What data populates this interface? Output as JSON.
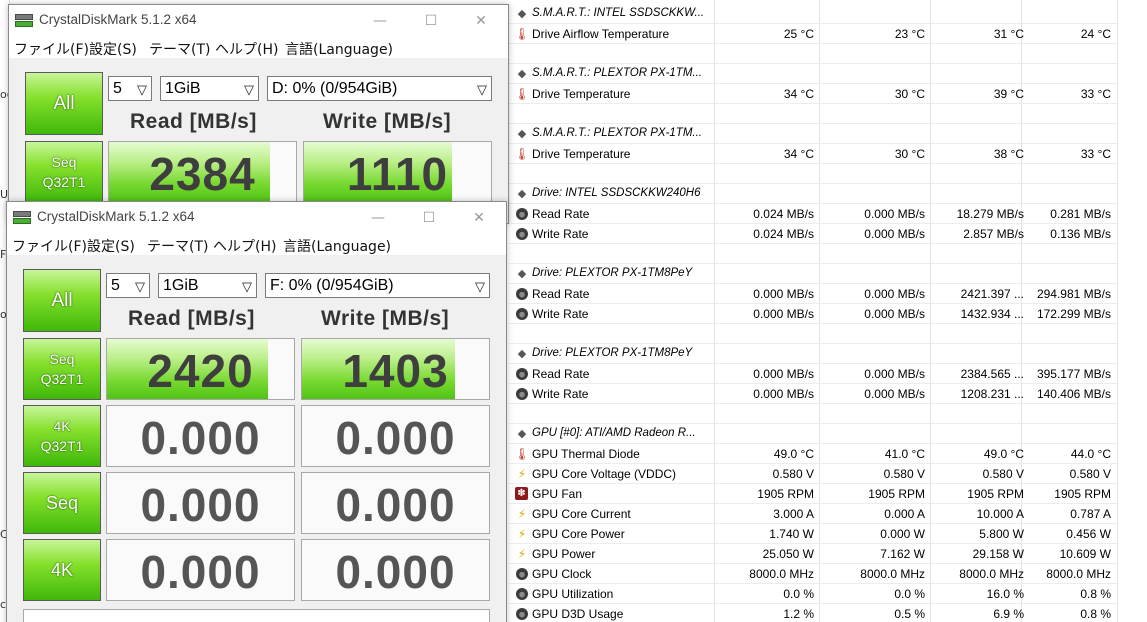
{
  "background": {
    "left_chars": [
      "ос",
      "U",
      "Fa",
      "ol",
      "C",
      "с"
    ]
  },
  "sensors": {
    "rows": [
      {
        "type": "header",
        "icon": "drive-icon",
        "label": "S.M.A.R.T.: INTEL SSDSCKKW..."
      },
      {
        "type": "row",
        "icon": "thermometer-icon",
        "label": "Drive Airflow Temperature",
        "values": [
          "25 °C",
          "23 °C",
          "31 °C",
          "24 °C"
        ]
      },
      {
        "type": "blank"
      },
      {
        "type": "header",
        "icon": "drive-icon",
        "label": "S.M.A.R.T.: PLEXTOR PX-1TM..."
      },
      {
        "type": "row",
        "icon": "thermometer-icon",
        "label": "Drive Temperature",
        "values": [
          "34 °C",
          "30 °C",
          "39 °C",
          "33 °C"
        ]
      },
      {
        "type": "blank"
      },
      {
        "type": "header",
        "icon": "drive-icon",
        "label": "S.M.A.R.T.: PLEXTOR PX-1TM..."
      },
      {
        "type": "row",
        "icon": "thermometer-icon",
        "label": "Drive Temperature",
        "values": [
          "34 °C",
          "30 °C",
          "38 °C",
          "33 °C"
        ]
      },
      {
        "type": "blank"
      },
      {
        "type": "header",
        "icon": "drive-icon",
        "label": "Drive: INTEL SSDSCKKW240H6"
      },
      {
        "type": "row",
        "icon": "gauge-icon",
        "label": "Read Rate",
        "values": [
          "0.024 MB/s",
          "0.000 MB/s",
          "18.279 MB/s",
          "0.281 MB/s"
        ]
      },
      {
        "type": "row",
        "icon": "gauge-icon",
        "label": "Write Rate",
        "values": [
          "0.024 MB/s",
          "0.000 MB/s",
          "2.857 MB/s",
          "0.136 MB/s"
        ]
      },
      {
        "type": "blank"
      },
      {
        "type": "header",
        "icon": "drive-icon",
        "label": "Drive: PLEXTOR PX-1TM8PeY"
      },
      {
        "type": "row",
        "icon": "gauge-icon",
        "label": "Read Rate",
        "values": [
          "0.000 MB/s",
          "0.000 MB/s",
          "2421.397 ...",
          "294.981 MB/s"
        ]
      },
      {
        "type": "row",
        "icon": "gauge-icon",
        "label": "Write Rate",
        "values": [
          "0.000 MB/s",
          "0.000 MB/s",
          "1432.934 ...",
          "172.299 MB/s"
        ]
      },
      {
        "type": "blank"
      },
      {
        "type": "header",
        "icon": "drive-icon",
        "label": "Drive: PLEXTOR PX-1TM8PeY"
      },
      {
        "type": "row",
        "icon": "gauge-icon",
        "label": "Read Rate",
        "values": [
          "0.000 MB/s",
          "0.000 MB/s",
          "2384.565 ...",
          "395.177 MB/s"
        ]
      },
      {
        "type": "row",
        "icon": "gauge-icon",
        "label": "Write Rate",
        "values": [
          "0.000 MB/s",
          "0.000 MB/s",
          "1208.231 ...",
          "140.406 MB/s"
        ]
      },
      {
        "type": "blank"
      },
      {
        "type": "header",
        "icon": "gpu-icon",
        "label": "GPU [#0]: ATI/AMD Radeon R..."
      },
      {
        "type": "row",
        "icon": "thermometer-icon",
        "label": "GPU Thermal Diode",
        "values": [
          "49.0 °C",
          "41.0 °C",
          "49.0 °C",
          "44.0 °C"
        ]
      },
      {
        "type": "row",
        "icon": "bolt-icon",
        "label": "GPU Core Voltage (VDDC)",
        "values": [
          "0.580 V",
          "0.580 V",
          "0.580 V",
          "0.580 V"
        ]
      },
      {
        "type": "row",
        "icon": "fan-icon",
        "label": "GPU Fan",
        "values": [
          "1905 RPM",
          "1905 RPM",
          "1905 RPM",
          "1905 RPM"
        ]
      },
      {
        "type": "row",
        "icon": "bolt-icon",
        "label": "GPU Core Current",
        "values": [
          "3.000 A",
          "0.000 A",
          "10.000 A",
          "0.787 A"
        ]
      },
      {
        "type": "row",
        "icon": "bolt-icon",
        "label": "GPU Core Power",
        "values": [
          "1.740 W",
          "0.000 W",
          "5.800 W",
          "0.456 W"
        ]
      },
      {
        "type": "row",
        "icon": "bolt-icon",
        "label": "GPU Power",
        "values": [
          "25.050 W",
          "7.162 W",
          "29.158 W",
          "10.609 W"
        ]
      },
      {
        "type": "row",
        "icon": "gauge-icon",
        "label": "GPU Clock",
        "values": [
          "8000.0 MHz",
          "8000.0 MHz",
          "8000.0 MHz",
          "8000.0 MHz"
        ]
      },
      {
        "type": "row",
        "icon": "gauge-icon",
        "label": "GPU Utilization",
        "values": [
          "0.0 %",
          "0.0 %",
          "16.0 %",
          "0.8 %"
        ]
      },
      {
        "type": "row",
        "icon": "gauge-icon",
        "label": "GPU D3D Usage",
        "values": [
          "1.2 %",
          "0.5 %",
          "6.9 %",
          "0.8 %"
        ]
      }
    ]
  },
  "cdm_back": {
    "title": "CrystalDiskMark 5.1.2 x64",
    "minimize": "—",
    "maximize": "☐",
    "close": "✕",
    "menu": [
      "ファイル(F)",
      "設定(S)",
      "テーマ(T)",
      "ヘルプ(H)",
      "言語(Language)"
    ],
    "all_label": "All",
    "count": "5",
    "size": "1GiB",
    "drive": "D: 0% (0/954GiB)",
    "read_header": "Read [MB/s]",
    "write_header": "Write [MB/s]",
    "seq_label": "Seq\nQ32T1",
    "read_value": "2384",
    "write_value": "1110",
    "read_fill": 0.86,
    "write_fill": 0.79
  },
  "cdm_front": {
    "title": "CrystalDiskMark 5.1.2 x64",
    "minimize": "—",
    "maximize": "☐",
    "close": "✕",
    "menu": [
      "ファイル(F)",
      "設定(S)",
      "テーマ(T)",
      "ヘルプ(H)",
      "言語(Language)"
    ],
    "all_label": "All",
    "count": "5",
    "size": "1GiB",
    "drive": "F: 0% (0/954GiB)",
    "read_header": "Read [MB/s]",
    "write_header": "Write [MB/s]",
    "tests": [
      {
        "label_line1": "Seq",
        "label_line2": "Q32T1",
        "read": "2420",
        "write": "1403",
        "read_fill": 0.86,
        "write_fill": 0.82
      },
      {
        "label_line1": "4K",
        "label_line2": "Q32T1",
        "read": "0.000",
        "write": "0.000",
        "read_fill": 0,
        "write_fill": 0
      },
      {
        "label_line1": "Seq",
        "label_line2": "",
        "read": "0.000",
        "write": "0.000",
        "read_fill": 0,
        "write_fill": 0
      },
      {
        "label_line1": "4K",
        "label_line2": "",
        "read": "0.000",
        "write": "0.000",
        "read_fill": 0,
        "write_fill": 0
      }
    ]
  }
}
